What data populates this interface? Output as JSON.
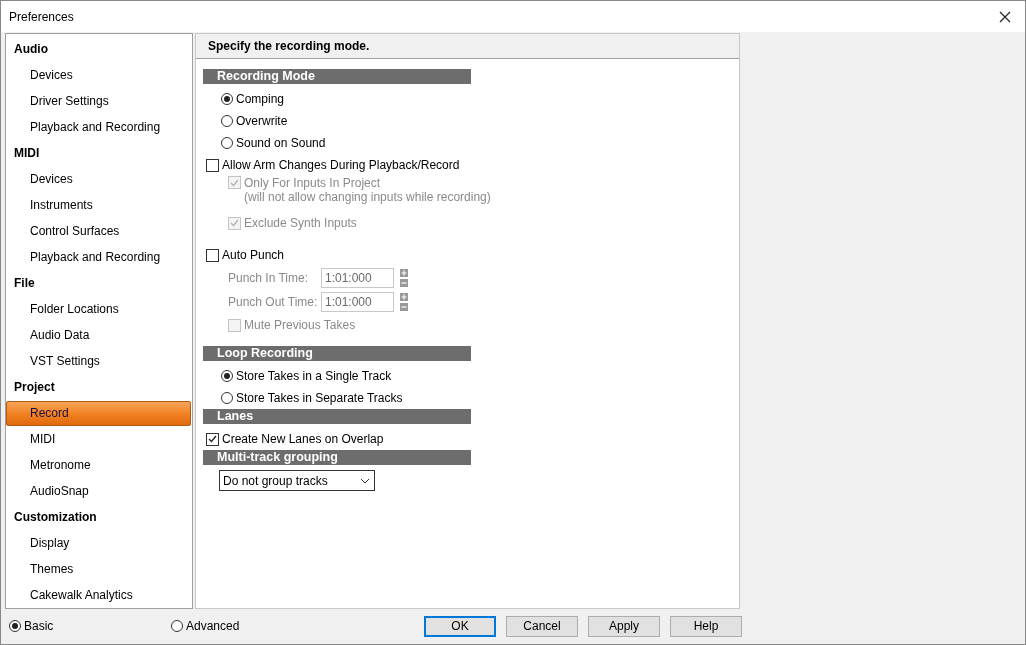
{
  "window": {
    "title": "Preferences"
  },
  "sidebar": {
    "groups": [
      {
        "label": "Audio",
        "items": [
          {
            "label": "Devices",
            "selected": false
          },
          {
            "label": "Driver Settings",
            "selected": false
          },
          {
            "label": "Playback and Recording",
            "selected": false
          }
        ]
      },
      {
        "label": "MIDI",
        "items": [
          {
            "label": "Devices",
            "selected": false
          },
          {
            "label": "Instruments",
            "selected": false
          },
          {
            "label": "Control Surfaces",
            "selected": false
          },
          {
            "label": "Playback and Recording",
            "selected": false
          }
        ]
      },
      {
        "label": "File",
        "items": [
          {
            "label": "Folder Locations",
            "selected": false
          },
          {
            "label": "Audio Data",
            "selected": false
          },
          {
            "label": "VST Settings",
            "selected": false
          }
        ]
      },
      {
        "label": "Project",
        "items": [
          {
            "label": "Record",
            "selected": true
          },
          {
            "label": "MIDI",
            "selected": false
          },
          {
            "label": "Metronome",
            "selected": false
          },
          {
            "label": "AudioSnap",
            "selected": false
          }
        ]
      },
      {
        "label": "Customization",
        "items": [
          {
            "label": "Display",
            "selected": false
          },
          {
            "label": "Themes",
            "selected": false
          },
          {
            "label": "Cakewalk Analytics",
            "selected": false
          }
        ]
      }
    ]
  },
  "header": "Specify the recording mode.",
  "sections": [
    {
      "title": "Recording Mode",
      "items": [
        {
          "kind": "radio",
          "label": "Comping",
          "selected": true
        },
        {
          "kind": "radio",
          "label": "Overwrite",
          "selected": false
        },
        {
          "kind": "radio",
          "label": "Sound on Sound",
          "selected": false
        },
        {
          "kind": "checkbox",
          "label": "Allow Arm Changes During Playback/Record",
          "checked": false,
          "disabled": false,
          "children": [
            {
              "kind": "checkbox",
              "label": "Only For Inputs In Project",
              "note": "(will not allow changing inputs while recording)",
              "checked": true,
              "disabled": true
            },
            {
              "kind": "checkbox",
              "label": "Exclude Synth Inputs",
              "checked": true,
              "disabled": true
            }
          ]
        },
        {
          "kind": "checkbox",
          "label": "Auto Punch",
          "checked": false,
          "disabled": false,
          "children": [
            {
              "kind": "time",
              "label": "Punch In Time:",
              "value": "1:01:000",
              "disabled": true
            },
            {
              "kind": "time",
              "label": "Punch Out Time:",
              "value": "1:01:000",
              "disabled": true
            },
            {
              "kind": "checkbox",
              "label": "Mute Previous Takes",
              "checked": false,
              "disabled": true
            }
          ]
        }
      ]
    },
    {
      "title": "Loop Recording",
      "items": [
        {
          "kind": "radio",
          "label": "Store Takes in a Single Track",
          "selected": true
        },
        {
          "kind": "radio",
          "label": "Store Takes in Separate Tracks",
          "selected": false
        }
      ]
    },
    {
      "title": "Lanes",
      "items": [
        {
          "kind": "checkbox",
          "label": "Create New Lanes on Overlap",
          "checked": true,
          "disabled": false
        }
      ]
    },
    {
      "title": "Multi-track grouping",
      "items": [
        {
          "kind": "dropdown",
          "value": "Do not group tracks"
        }
      ]
    }
  ],
  "modes": [
    {
      "label": "Basic",
      "selected": true
    },
    {
      "label": "Advanced",
      "selected": false
    }
  ],
  "buttons": [
    {
      "label": "OK",
      "default": true
    },
    {
      "label": "Cancel",
      "default": false
    },
    {
      "label": "Apply",
      "default": false
    },
    {
      "label": "Help",
      "default": false
    }
  ]
}
